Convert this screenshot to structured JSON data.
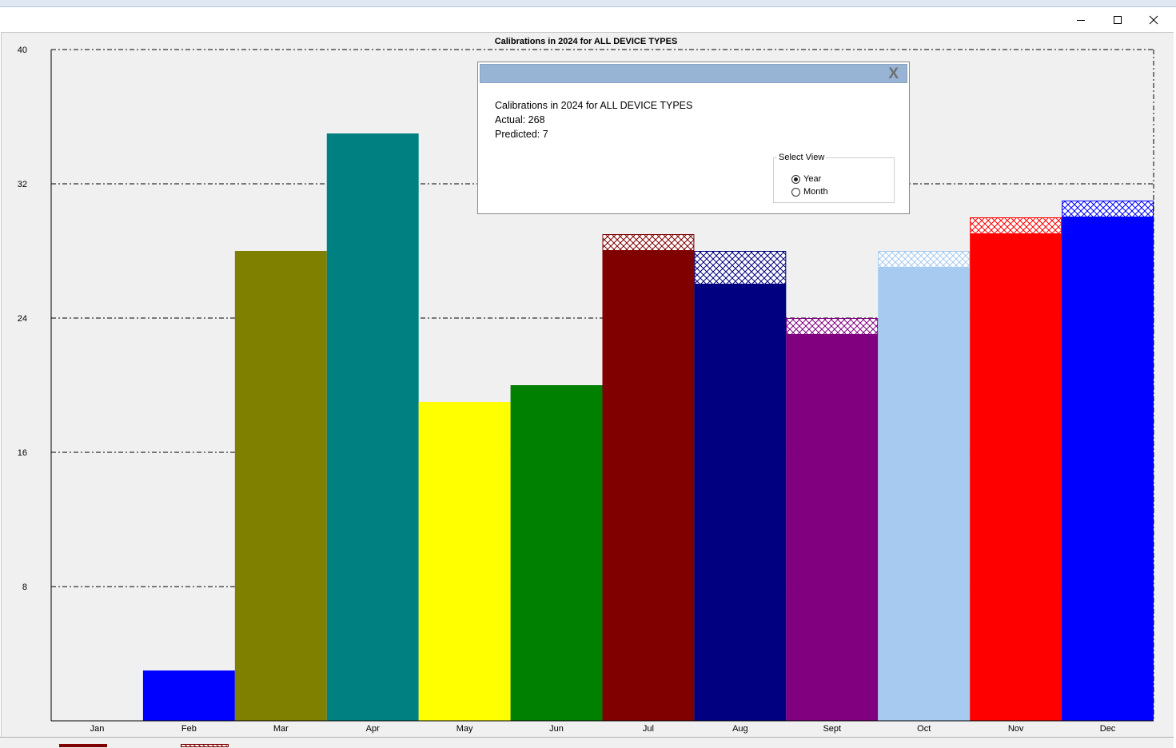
{
  "window": {
    "controls": [
      "minimize",
      "maximize",
      "close"
    ]
  },
  "chart_data": {
    "type": "bar",
    "title": "Calibrations in 2024 for ALL DEVICE TYPES",
    "categories": [
      "Jan",
      "Feb",
      "Mar",
      "Apr",
      "May",
      "Jun",
      "Jul",
      "Aug",
      "Sept",
      "Oct",
      "Nov",
      "Dec"
    ],
    "series": [
      {
        "values": [
          0,
          3,
          28,
          35,
          19,
          20,
          28,
          26,
          23,
          27,
          29,
          30
        ]
      },
      {
        "values": [
          0,
          0,
          0,
          0,
          0,
          0,
          1,
          2,
          1,
          1,
          1,
          1
        ]
      }
    ],
    "bar_colors": [
      "#0000ff",
      "#0000ff",
      "#808000",
      "#008080",
      "#ffff00",
      "#008000",
      "#800000",
      "#000080",
      "#800080",
      "#a6caf0",
      "#ff0000",
      "#0000ff"
    ],
    "y_ticks": [
      8,
      16,
      24,
      32,
      40
    ],
    "ylim": [
      0,
      40
    ],
    "grid": true,
    "grid_style": "dash-dot"
  },
  "popup": {
    "close_label": "X",
    "title": "Calibrations in 2024 for ALL DEVICE TYPES",
    "actual": "Actual: 268",
    "predicted": "Predicted: 7",
    "select_view": {
      "label": "Select View",
      "options": [
        "Year",
        "Month"
      ],
      "selected": "Year"
    }
  },
  "legend": {
    "colors": [
      "#800000",
      "#800000"
    ]
  }
}
